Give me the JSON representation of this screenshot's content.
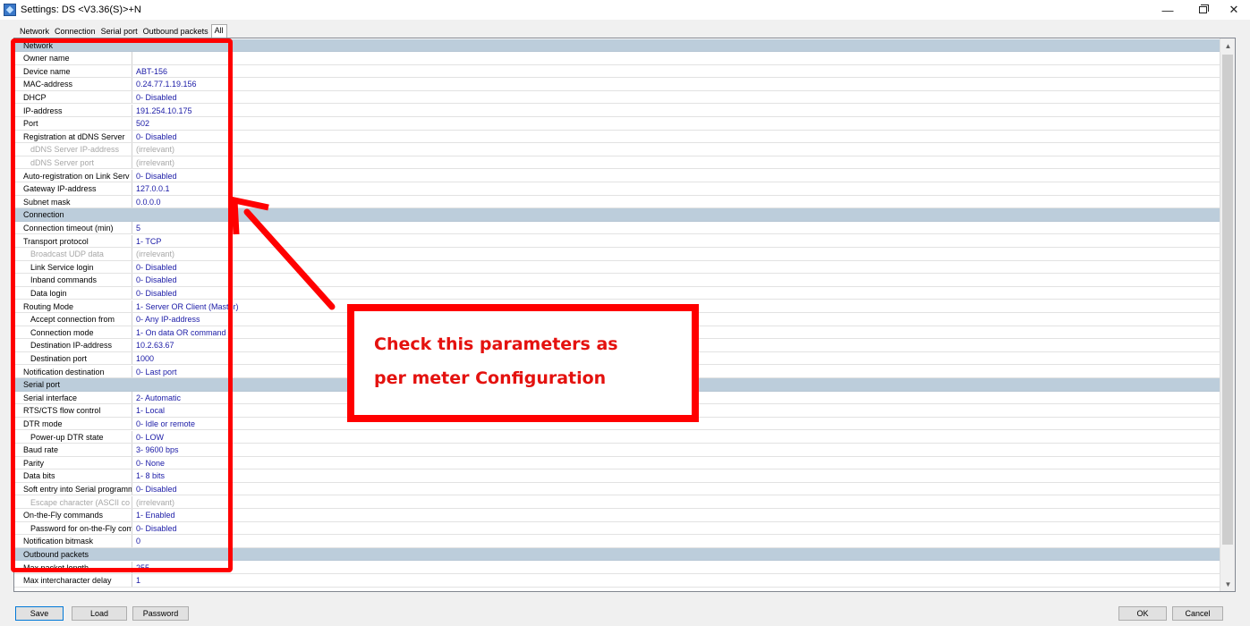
{
  "window": {
    "title": "Settings: DS <V3.36(S)>+N",
    "minimize_glyph": "—",
    "close_glyph": "✕"
  },
  "tabs": [
    "Network",
    "Connection",
    "Serial port",
    "Outbound packets",
    "All"
  ],
  "active_tab_index": 4,
  "rows": [
    {
      "type": "section",
      "label": "Network"
    },
    {
      "name": "Owner name",
      "value": ""
    },
    {
      "name": "Device name",
      "value": "ABT-156"
    },
    {
      "name": "MAC-address",
      "value": "0.24.77.1.19.156"
    },
    {
      "name": "DHCP",
      "value": "0- Disabled"
    },
    {
      "name": "IP-address",
      "value": "191.254.10.175"
    },
    {
      "name": "Port",
      "value": "502"
    },
    {
      "name": "Registration at dDNS Server",
      "value": "0- Disabled"
    },
    {
      "name": "dDNS Server IP-address",
      "value": "(irrelevant)",
      "indent": true,
      "dim": true
    },
    {
      "name": "dDNS Server port",
      "value": "(irrelevant)",
      "indent": true,
      "dim": true
    },
    {
      "name": "Auto-registration on Link Serv",
      "value": "0- Disabled"
    },
    {
      "name": "Gateway IP-address",
      "value": "127.0.0.1"
    },
    {
      "name": "Subnet mask",
      "value": "0.0.0.0"
    },
    {
      "type": "section",
      "label": "Connection"
    },
    {
      "name": "Connection timeout (min)",
      "value": "5"
    },
    {
      "name": "Transport protocol",
      "value": "1- TCP"
    },
    {
      "name": "Broadcast UDP data",
      "value": "(irrelevant)",
      "indent": true,
      "dim": true
    },
    {
      "name": "Link Service login",
      "value": "0- Disabled",
      "indent": true
    },
    {
      "name": "Inband commands",
      "value": "0- Disabled",
      "indent": true
    },
    {
      "name": "Data login",
      "value": "0- Disabled",
      "indent": true
    },
    {
      "name": "Routing Mode",
      "value": "1- Server OR Client (Master)"
    },
    {
      "name": "Accept connection from",
      "value": "0- Any IP-address",
      "indent": true
    },
    {
      "name": "Connection mode",
      "value": "1- On data OR command",
      "indent": true
    },
    {
      "name": "Destination IP-address",
      "value": "10.2.63.67",
      "indent": true
    },
    {
      "name": "Destination port",
      "value": "1000",
      "indent": true
    },
    {
      "name": "Notification destination",
      "value": "0- Last port"
    },
    {
      "type": "section",
      "label": "Serial port"
    },
    {
      "name": "Serial interface",
      "value": "2- Automatic"
    },
    {
      "name": "RTS/CTS flow control",
      "value": "1- Local"
    },
    {
      "name": "DTR mode",
      "value": "0- Idle or remote"
    },
    {
      "name": "Power-up DTR state",
      "value": "0- LOW",
      "indent": true
    },
    {
      "name": "Baud rate",
      "value": "3- 9600 bps"
    },
    {
      "name": "Parity",
      "value": "0- None"
    },
    {
      "name": "Data bits",
      "value": "1- 8 bits"
    },
    {
      "name": "Soft entry into Serial programm",
      "value": "0- Disabled"
    },
    {
      "name": "Escape character (ASCII co",
      "value": "(irrelevant)",
      "indent": true,
      "dim": true
    },
    {
      "name": "On-the-Fly commands",
      "value": "1- Enabled"
    },
    {
      "name": "Password for on-the-Fly com",
      "value": "0- Disabled",
      "indent": true
    },
    {
      "name": "Notification bitmask",
      "value": "0"
    },
    {
      "type": "section",
      "label": "Outbound packets"
    },
    {
      "name": "Max packet length",
      "value": "255"
    },
    {
      "name": "Max intercharacter delay",
      "value": "1"
    }
  ],
  "annotation": {
    "callout_line1": "Check this parameters as",
    "callout_line2": "per meter Configuration",
    "color": "#ff0000"
  },
  "buttons": {
    "save": "Save",
    "load": "Load",
    "password": "Password",
    "ok": "OK",
    "cancel": "Cancel"
  },
  "colors": {
    "section_bg": "#bccddb",
    "value_text": "#1a1aa6",
    "dim_text": "#a7a7a7"
  }
}
